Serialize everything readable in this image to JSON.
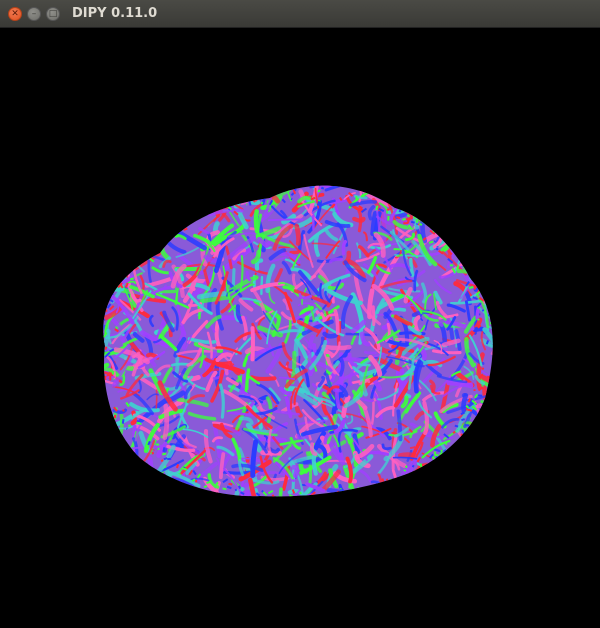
{
  "window": {
    "title": "DIPY 0.11.0",
    "buttons": {
      "close_icon": "close-icon",
      "minimize_icon": "minimize-icon",
      "maximize_icon": "maximize-icon"
    }
  },
  "viewport": {
    "background": "#000000",
    "rendering": "tractography-fibers",
    "direction_colors": [
      "#ff2a3c",
      "#2b3cff",
      "#3cff3c",
      "#a040ff",
      "#ff60c0",
      "#40d0d0"
    ]
  }
}
